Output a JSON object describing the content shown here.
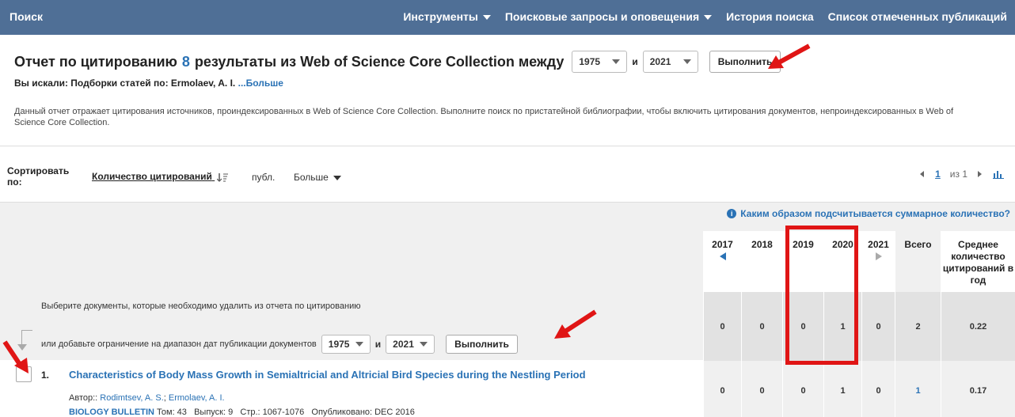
{
  "topbar": {
    "search": "Поиск",
    "tools": "Инструменты",
    "saved_searches": "Поисковые запросы и оповещения",
    "history": "История поиска",
    "marked_list": "Список отмеченных публикаций"
  },
  "header": {
    "title_prefix": "Отчет по цитированию",
    "count": "8",
    "title_suffix": "результаты из Web of Science Core Collection между",
    "year_from": "1975",
    "and": "и",
    "year_to": "2021",
    "run": "Выполнить"
  },
  "searched": {
    "label": "Вы искали: Подборки статей по: Ermolaev, A. I.",
    "more": "...Больше"
  },
  "description": "Данный отчет отражает цитирования источников, проиндексированных в Web of Science Core Collection. Выполните поиск по пристатейной библиографии, чтобы включить цитирования документов, непроиндексированных в Web of Science Core Collection.",
  "sort": {
    "label": "Сортировать по:",
    "active": "Количество цитирований",
    "publ": "публ.",
    "more": "Больше"
  },
  "pager": {
    "page": "1",
    "of": "из 1"
  },
  "info_link": "Каким образом подсчитывается суммарное количество?",
  "table": {
    "years": [
      "2017",
      "2018",
      "2019",
      "2020",
      "2021"
    ],
    "total_label": "Всего",
    "avg_label": "Среднее количество цитирований в год",
    "summary": [
      "0",
      "0",
      "0",
      "1",
      "0",
      "2",
      "0.22"
    ],
    "remove_text": "Выберите документы, которые необходимо удалить из отчета по цитированию",
    "limit_text": "или добавьте ограничение на диапазон дат публикации документов",
    "limit_from": "1975",
    "limit_and": "и",
    "limit_to": "2021",
    "limit_run": "Выполнить"
  },
  "publication": {
    "index": "1.",
    "title": "Characteristics of Body Mass Growth in Semialtricial and Altricial Bird Species during the Nestling Period",
    "authors_label": "Автор::",
    "author1": "Rodimtsev, A. S.",
    "author2": "Ermolaev, A. I.",
    "journal": "BIOLOGY BULLETIN",
    "details": "Том: 43   Выпуск: 9   Стр.: 1067-1076   Опубликовано: DEC 2016",
    "values": [
      "0",
      "0",
      "0",
      "1",
      "0",
      "1",
      "0.17"
    ]
  },
  "colors": {
    "topbar": "#4f6f96",
    "link": "#2a72b5",
    "annotation": "#e01515"
  },
  "icons": [
    "caret-down-icon",
    "sort-desc-icon",
    "bar-chart-icon",
    "info-icon",
    "arrow-left-icon",
    "arrow-right-icon",
    "red-arrow-annotation"
  ]
}
